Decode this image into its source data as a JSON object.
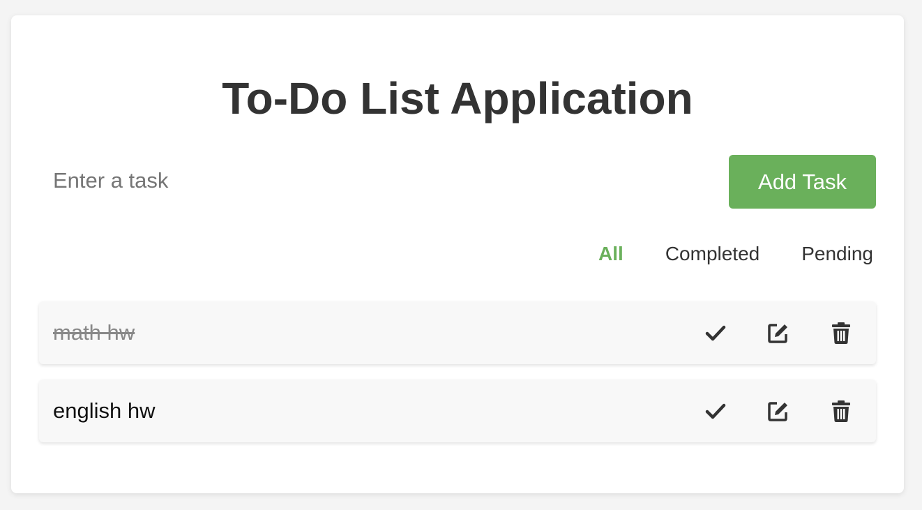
{
  "app": {
    "title": "To-Do List Application"
  },
  "input": {
    "placeholder": "Enter a task",
    "value": ""
  },
  "add_button": {
    "label": "Add Task"
  },
  "filters": [
    {
      "label": "All",
      "active": true
    },
    {
      "label": "Completed",
      "active": false
    },
    {
      "label": "Pending",
      "active": false
    }
  ],
  "tasks": [
    {
      "text": "math hw",
      "completed": true
    },
    {
      "text": "english hw",
      "completed": false
    }
  ],
  "icons": {
    "complete": "check-icon",
    "edit": "edit-icon",
    "delete": "trash-icon"
  },
  "colors": {
    "accent": "#6ab05b",
    "text": "#333333",
    "muted": "#888888"
  }
}
